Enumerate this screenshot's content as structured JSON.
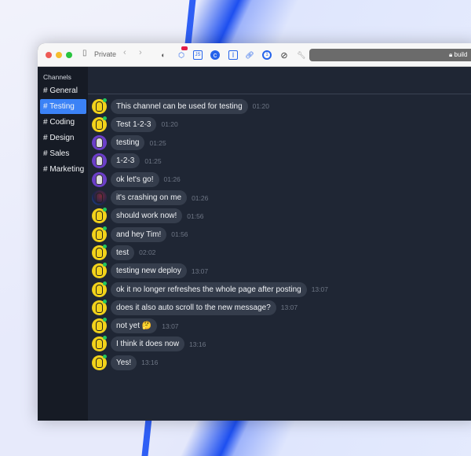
{
  "browser": {
    "mode_label": "Private",
    "url": "build",
    "extension_badge_color": "#e11d48"
  },
  "sidebar": {
    "title": "Channels",
    "channels": [
      {
        "label": "# General",
        "active": false
      },
      {
        "label": "# Testing",
        "active": true
      },
      {
        "label": "# Coding",
        "active": false
      },
      {
        "label": "# Design",
        "active": false
      },
      {
        "label": "# Sales",
        "active": false
      },
      {
        "label": "# Marketing",
        "active": false
      }
    ]
  },
  "messages": [
    {
      "user": "a",
      "text": "This channel can be used for testing",
      "time": "01:20"
    },
    {
      "user": "a",
      "text": "Test 1-2-3",
      "time": "01:20"
    },
    {
      "user": "b",
      "text": "testing",
      "time": "01:25"
    },
    {
      "user": "b",
      "text": "1-2-3",
      "time": "01:25"
    },
    {
      "user": "b",
      "text": "ok let's go!",
      "time": "01:26"
    },
    {
      "user": "c",
      "text": "it's crashing on me",
      "time": "01:26"
    },
    {
      "user": "a",
      "text": "should work now!",
      "time": "01:56"
    },
    {
      "user": "a",
      "text": "and hey Tim!",
      "time": "01:56"
    },
    {
      "user": "a",
      "text": "test",
      "time": "02:02"
    },
    {
      "user": "a",
      "text": "testing new deploy",
      "time": "13:07"
    },
    {
      "user": "a",
      "text": "ok it no longer refreshes the whole page after posting",
      "time": "13:07"
    },
    {
      "user": "a",
      "text": "does it also auto scroll to the new message?",
      "time": "13:07"
    },
    {
      "user": "a",
      "text": "not yet 🤔",
      "time": "13:07"
    },
    {
      "user": "a",
      "text": "I think it does now",
      "time": "13:16"
    },
    {
      "user": "a",
      "text": "Yes!",
      "time": "13:16"
    }
  ]
}
